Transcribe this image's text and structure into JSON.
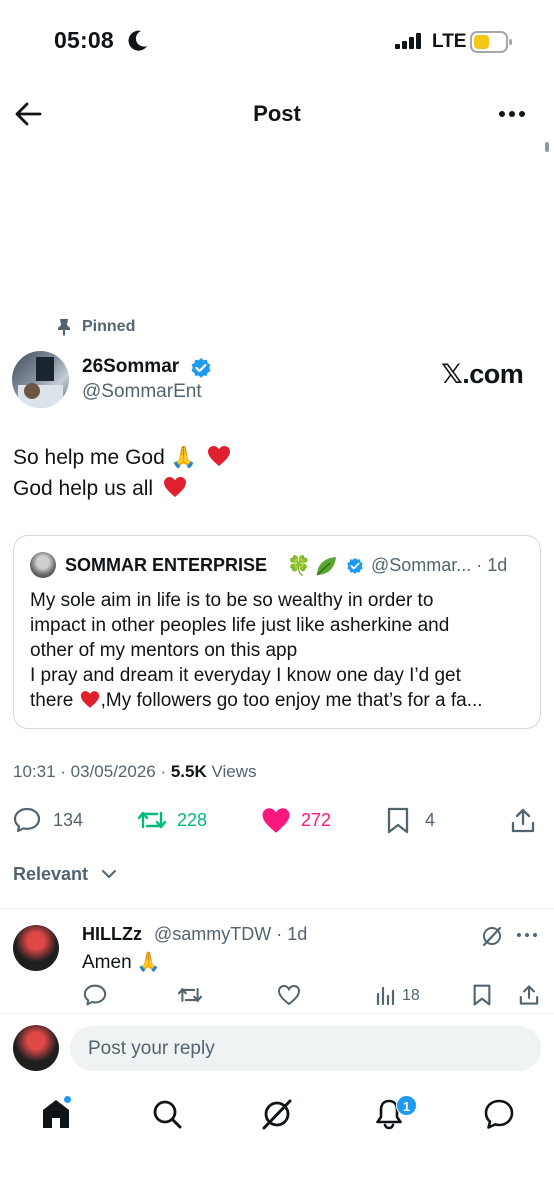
{
  "status_bar": {
    "time": "05:08",
    "network": "LTE"
  },
  "header": {
    "title": "Post"
  },
  "post": {
    "pinned_label": "Pinned",
    "author_name": "26Sommar",
    "author_handle": "@SommarEnt",
    "brand": "𝕏.com",
    "text_line1": "So help me God 🙏",
    "text_line2": "God help us all",
    "timestamp": "10:31 · 03/05/2026 · ",
    "views_count": "5.5K",
    "views_label": " Views",
    "replies": "134",
    "reposts": "228",
    "likes": "272",
    "bookmarks": "4"
  },
  "quote": {
    "author_name": "SOMMAR ENTERPRISE",
    "emoji_clover": "🍀",
    "handle_time": "@Sommar... · 1d",
    "text_line1": "My sole aim in life is to be so wealthy in order to",
    "text_line2": "impact in other peoples life just like asherkine and",
    "text_line3": "other of my mentors on this app",
    "text_line4": "I pray and dream it everyday I know one day I’d get",
    "text_line5a": "there",
    "text_line5b": ",My followers go too enjoy me that’s for a fa..."
  },
  "sort": {
    "label": "Relevant"
  },
  "reply": {
    "author_name": "HILLZz",
    "handle_time": "@sammyTDW · 1d",
    "text": "Amen 🙏",
    "views": "18"
  },
  "compose": {
    "placeholder": "Post your reply"
  },
  "nav": {
    "notifications_badge": "1"
  },
  "colors": {
    "accent": "#1d9bf0",
    "repost": "#00ba7c",
    "like": "#f91880",
    "secondary_text": "#536471"
  }
}
